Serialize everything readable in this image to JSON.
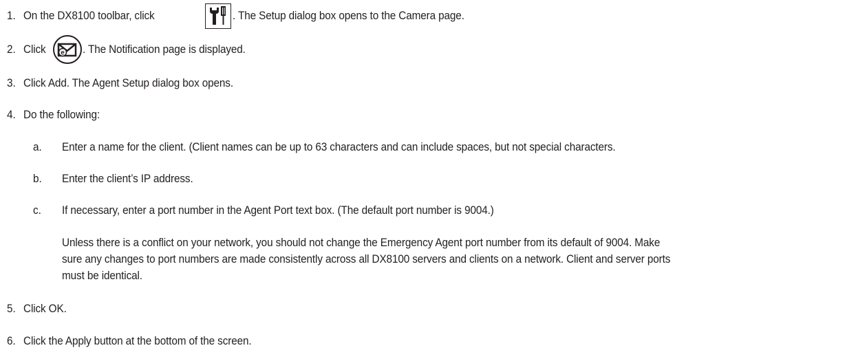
{
  "steps": [
    {
      "num": "1.",
      "pre": "On the DX8100 toolbar, click",
      "icon": "setup-tools-icon",
      "post": ". The Setup dialog box opens to the Camera page."
    },
    {
      "num": "2.",
      "pre": "Click",
      "icon": "notification-envelope-icon",
      "post": ". The Notification page is displayed."
    },
    {
      "num": "3.",
      "text": "Click Add. The Agent Setup dialog box opens."
    },
    {
      "num": "4.",
      "text": "Do the following:"
    },
    {
      "num": "5.",
      "text": "Click OK."
    },
    {
      "num": "6.",
      "text": "Click the Apply button at the bottom of the screen."
    }
  ],
  "substeps": [
    {
      "letter": "a.",
      "text": "Enter a name for the client. (Client names can be up to 63 characters and can include spaces, but not special characters."
    },
    {
      "letter": "b.",
      "text": "Enter the client’s IP address."
    },
    {
      "letter": "c.",
      "text": "If necessary, enter a port number in the Agent Port text box. (The default port number is 9004.)"
    }
  ],
  "note_lines": [
    "Unless there is a conflict on your network, you should not change the Emergency Agent port number from its default of 9004. Make",
    "sure any changes to port numbers are made consistently across all DX8100 servers and clients on a network. Client and server ports",
    "must be identical."
  ]
}
